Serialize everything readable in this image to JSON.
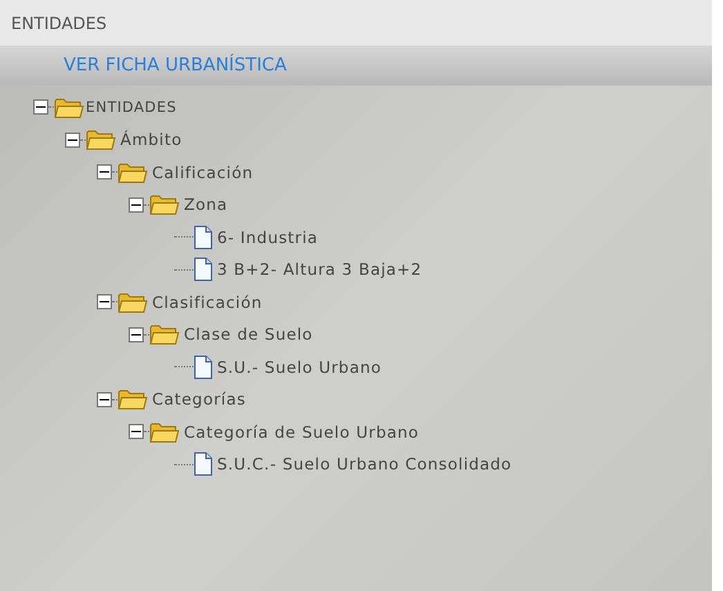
{
  "header": {
    "title": "ENTIDADES"
  },
  "action_bar": {
    "link": "VER FICHA URBANÍSTICA"
  },
  "tree": [
    {
      "label": "ENTIDADES",
      "kind": "folder",
      "expanded": true,
      "children": [
        {
          "label": "Ámbito",
          "kind": "folder",
          "expanded": true,
          "children": [
            {
              "label": "Calificación",
              "kind": "folder",
              "expanded": true,
              "children": [
                {
                  "label": "Zona",
                  "kind": "folder",
                  "expanded": true,
                  "children": [
                    {
                      "label": "6- Industria",
                      "kind": "document"
                    },
                    {
                      "label": "3 B+2- Altura 3 Baja+2",
                      "kind": "document"
                    }
                  ]
                }
              ]
            },
            {
              "label": "Clasificación",
              "kind": "folder",
              "expanded": true,
              "children": [
                {
                  "label": "Clase de Suelo",
                  "kind": "folder",
                  "expanded": true,
                  "children": [
                    {
                      "label": "S.U.- Suelo Urbano",
                      "kind": "document"
                    }
                  ]
                }
              ]
            },
            {
              "label": "Categorías",
              "kind": "folder",
              "expanded": true,
              "children": [
                {
                  "label": "Categoría de Suelo Urbano",
                  "kind": "folder",
                  "expanded": true,
                  "children": [
                    {
                      "label": "S.U.C.- Suelo Urbano Consolidado",
                      "kind": "document"
                    }
                  ]
                }
              ]
            }
          ]
        }
      ]
    }
  ]
}
